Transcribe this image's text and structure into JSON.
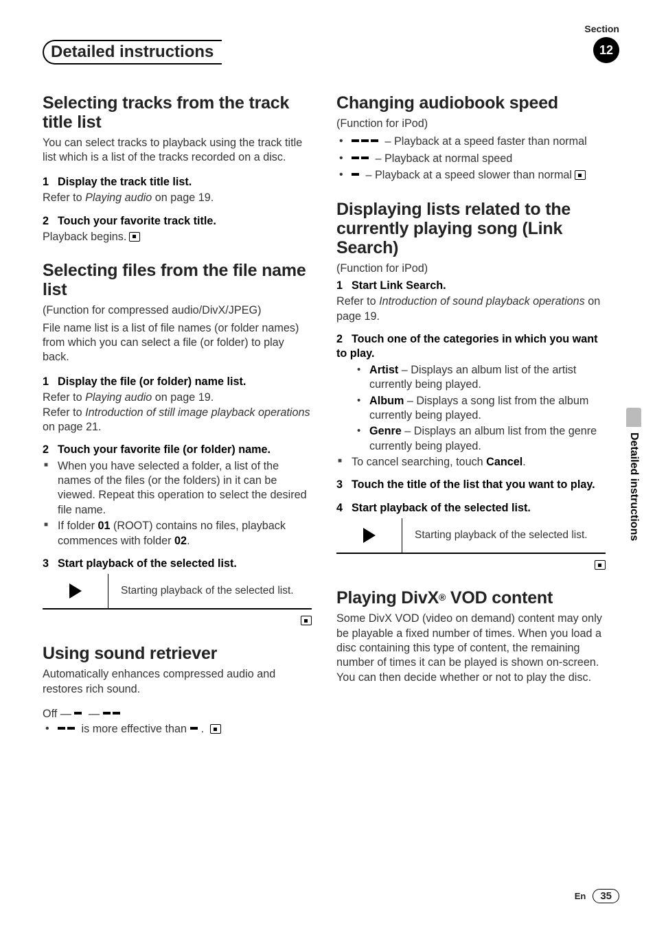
{
  "header": {
    "section_label": "Section",
    "title": "Detailed instructions",
    "number": "12"
  },
  "side_tab": "Detailed instructions",
  "footer": {
    "lang": "En",
    "page": "35"
  },
  "left": {
    "s1": {
      "h": "Selecting tracks from the track title list",
      "intro": "You can select tracks to playback using the track title list which is a list of the tracks recorded on a disc.",
      "step1_h": "Display the track title list.",
      "step1_ref_a": "Refer to ",
      "step1_ref_i": "Playing audio",
      "step1_ref_b": " on page 19.",
      "step2_h": "Touch your favorite track title.",
      "step2_txt": "Playback begins."
    },
    "s2": {
      "h": "Selecting files from the file name list",
      "p1": "(Function for compressed audio/DivX/JPEG)",
      "p2": "File name list is a list of file names (or folder names) from which you can select a file (or folder) to play back.",
      "step1_h": "Display the file (or folder) name list.",
      "step1_r1a": "Refer to ",
      "step1_r1i": "Playing audio",
      "step1_r1b": " on page 19.",
      "step1_r2a": "Refer to ",
      "step1_r2i": "Introduction of still image playback operations",
      "step1_r2b": " on page 21.",
      "step2_h": "Touch your favorite file (or folder) name.",
      "sq1": "When you have selected a folder, a list of the names of the files (or the folders) in it can be viewed. Repeat this operation to select the desired file name.",
      "sq2a": "If folder ",
      "sq2b": "01",
      "sq2c": " (ROOT) contains no files, playback commences with folder ",
      "sq2d": "02",
      "sq2e": ".",
      "step3_h": "Start playback of the selected list.",
      "play_desc": "Starting playback of the selected list."
    },
    "s3": {
      "h": "Using sound retriever",
      "p": "Automatically enhances compressed audio and restores rich sound.",
      "line": "Off —",
      "bullet_a": " is more effective than "
    }
  },
  "right": {
    "s4": {
      "h": "Changing audiobook speed",
      "sub": "(Function for iPod)",
      "b1": " – Playback at a speed faster than normal",
      "b2": " – Playback at normal speed",
      "b3": " – Playback at a speed slower than normal"
    },
    "s5": {
      "h": "Displaying lists related to the currently playing song (Link Search)",
      "sub": "(Function for iPod)",
      "step1_h": "Start Link Search.",
      "step1_ra": "Refer to ",
      "step1_ri": "Introduction of sound playback operations",
      "step1_rb": " on page 19.",
      "step2_h": "Touch one of the categories in which you want to play.",
      "cat_artist_b": "Artist",
      "cat_artist_t": " – Displays an album list of the artist currently being played.",
      "cat_album_b": "Album",
      "cat_album_t": " – Displays a song list from the album currently being played.",
      "cat_genre_b": "Genre",
      "cat_genre_t": " – Displays an album list from the genre currently being played.",
      "cancel_a": "To cancel searching, touch ",
      "cancel_b": "Cancel",
      "cancel_c": ".",
      "step3_h": "Touch the title of the list that you want to play.",
      "step4_h": "Start playback of the selected list.",
      "play_desc": "Starting playback of the selected list."
    },
    "s6": {
      "h_pre": "Playing DivX",
      "h_r": "®",
      "h_post": " VOD content",
      "p": "Some DivX VOD (video on demand) content may only be playable a fixed number of times. When you load a disc containing this type of content, the remaining number of times it can be played is shown on-screen. You can then decide whether or not to play the disc."
    }
  }
}
